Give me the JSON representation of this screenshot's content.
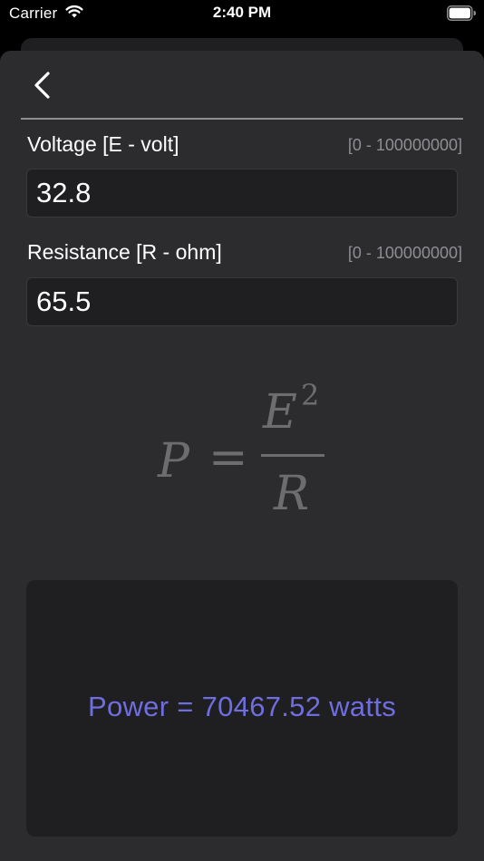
{
  "status_bar": {
    "carrier": "Carrier",
    "time": "2:40 PM",
    "icons": [
      "wifi-icon",
      "battery-icon"
    ]
  },
  "nav": {
    "back_icon": "chevron-left-icon"
  },
  "fields": [
    {
      "label": "Voltage [E - volt]",
      "range": "[0 - 100000000]",
      "value": "32.8"
    },
    {
      "label": "Resistance [R - ohm]",
      "range": "[0 - 100000000]",
      "value": "65.5"
    }
  ],
  "formula": {
    "lhs": "P",
    "equals": "=",
    "numerator": "E",
    "exponent": "2",
    "denominator": "R"
  },
  "result": {
    "text": "Power = 70467.52 watts"
  },
  "colors": {
    "background": "#000000",
    "sheet": "#2c2c2e",
    "input_bg": "#1f1f21",
    "range_text": "#8e8e93",
    "formula_text": "#6d6d70",
    "result_text": "#6e6ee0"
  }
}
